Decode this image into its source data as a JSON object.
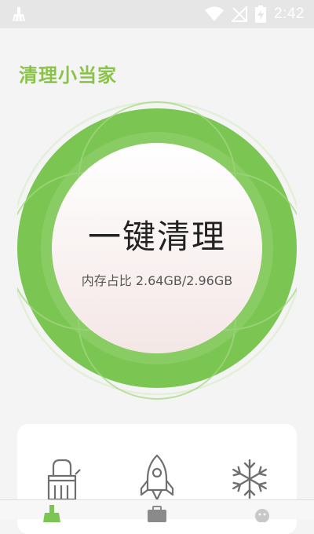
{
  "status_bar": {
    "time": "2:42",
    "icons": [
      "broom-notification-icon",
      "wifi-icon",
      "signal-off-icon",
      "battery-charging-icon"
    ]
  },
  "app": {
    "title": "清理小当家"
  },
  "clean": {
    "button_label": "一键清理",
    "memory_text": "内存占比 2.64GB/2.96GB",
    "memory_used_gb": 2.64,
    "memory_total_gb": 2.96
  },
  "tools": [
    {
      "icon": "brush-icon"
    },
    {
      "icon": "rocket-icon"
    },
    {
      "icon": "snowflake-icon"
    }
  ],
  "bottom_nav": {
    "items": [
      {
        "icon": "broom-nav-icon",
        "active": true
      },
      {
        "icon": "toolbox-nav-icon",
        "active": false
      },
      {
        "icon": "profile-nav-icon",
        "active": false
      }
    ]
  },
  "colors": {
    "accent": "#8bc34a",
    "ring": "#7bc552",
    "icon_gray": "#6f6f6f",
    "status_bar_bg": "#e6e6e6"
  }
}
